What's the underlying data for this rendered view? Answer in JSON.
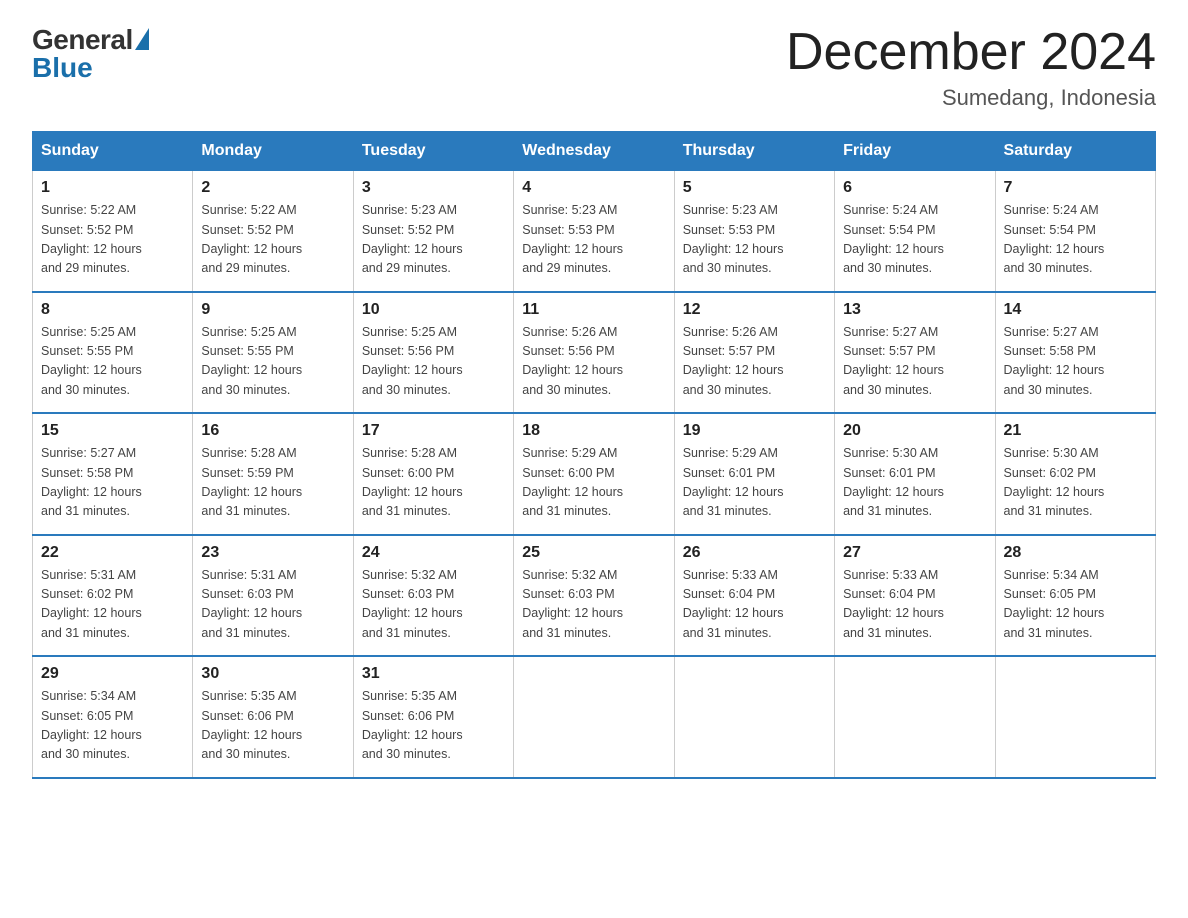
{
  "header": {
    "logo_general": "General",
    "logo_blue": "Blue",
    "title": "December 2024",
    "location": "Sumedang, Indonesia"
  },
  "days_of_week": [
    "Sunday",
    "Monday",
    "Tuesday",
    "Wednesday",
    "Thursday",
    "Friday",
    "Saturday"
  ],
  "weeks": [
    [
      {
        "day": "1",
        "sunrise": "5:22 AM",
        "sunset": "5:52 PM",
        "daylight": "12 hours and 29 minutes."
      },
      {
        "day": "2",
        "sunrise": "5:22 AM",
        "sunset": "5:52 PM",
        "daylight": "12 hours and 29 minutes."
      },
      {
        "day": "3",
        "sunrise": "5:23 AM",
        "sunset": "5:52 PM",
        "daylight": "12 hours and 29 minutes."
      },
      {
        "day": "4",
        "sunrise": "5:23 AM",
        "sunset": "5:53 PM",
        "daylight": "12 hours and 29 minutes."
      },
      {
        "day": "5",
        "sunrise": "5:23 AM",
        "sunset": "5:53 PM",
        "daylight": "12 hours and 30 minutes."
      },
      {
        "day": "6",
        "sunrise": "5:24 AM",
        "sunset": "5:54 PM",
        "daylight": "12 hours and 30 minutes."
      },
      {
        "day": "7",
        "sunrise": "5:24 AM",
        "sunset": "5:54 PM",
        "daylight": "12 hours and 30 minutes."
      }
    ],
    [
      {
        "day": "8",
        "sunrise": "5:25 AM",
        "sunset": "5:55 PM",
        "daylight": "12 hours and 30 minutes."
      },
      {
        "day": "9",
        "sunrise": "5:25 AM",
        "sunset": "5:55 PM",
        "daylight": "12 hours and 30 minutes."
      },
      {
        "day": "10",
        "sunrise": "5:25 AM",
        "sunset": "5:56 PM",
        "daylight": "12 hours and 30 minutes."
      },
      {
        "day": "11",
        "sunrise": "5:26 AM",
        "sunset": "5:56 PM",
        "daylight": "12 hours and 30 minutes."
      },
      {
        "day": "12",
        "sunrise": "5:26 AM",
        "sunset": "5:57 PM",
        "daylight": "12 hours and 30 minutes."
      },
      {
        "day": "13",
        "sunrise": "5:27 AM",
        "sunset": "5:57 PM",
        "daylight": "12 hours and 30 minutes."
      },
      {
        "day": "14",
        "sunrise": "5:27 AM",
        "sunset": "5:58 PM",
        "daylight": "12 hours and 30 minutes."
      }
    ],
    [
      {
        "day": "15",
        "sunrise": "5:27 AM",
        "sunset": "5:58 PM",
        "daylight": "12 hours and 31 minutes."
      },
      {
        "day": "16",
        "sunrise": "5:28 AM",
        "sunset": "5:59 PM",
        "daylight": "12 hours and 31 minutes."
      },
      {
        "day": "17",
        "sunrise": "5:28 AM",
        "sunset": "6:00 PM",
        "daylight": "12 hours and 31 minutes."
      },
      {
        "day": "18",
        "sunrise": "5:29 AM",
        "sunset": "6:00 PM",
        "daylight": "12 hours and 31 minutes."
      },
      {
        "day": "19",
        "sunrise": "5:29 AM",
        "sunset": "6:01 PM",
        "daylight": "12 hours and 31 minutes."
      },
      {
        "day": "20",
        "sunrise": "5:30 AM",
        "sunset": "6:01 PM",
        "daylight": "12 hours and 31 minutes."
      },
      {
        "day": "21",
        "sunrise": "5:30 AM",
        "sunset": "6:02 PM",
        "daylight": "12 hours and 31 minutes."
      }
    ],
    [
      {
        "day": "22",
        "sunrise": "5:31 AM",
        "sunset": "6:02 PM",
        "daylight": "12 hours and 31 minutes."
      },
      {
        "day": "23",
        "sunrise": "5:31 AM",
        "sunset": "6:03 PM",
        "daylight": "12 hours and 31 minutes."
      },
      {
        "day": "24",
        "sunrise": "5:32 AM",
        "sunset": "6:03 PM",
        "daylight": "12 hours and 31 minutes."
      },
      {
        "day": "25",
        "sunrise": "5:32 AM",
        "sunset": "6:03 PM",
        "daylight": "12 hours and 31 minutes."
      },
      {
        "day": "26",
        "sunrise": "5:33 AM",
        "sunset": "6:04 PM",
        "daylight": "12 hours and 31 minutes."
      },
      {
        "day": "27",
        "sunrise": "5:33 AM",
        "sunset": "6:04 PM",
        "daylight": "12 hours and 31 minutes."
      },
      {
        "day": "28",
        "sunrise": "5:34 AM",
        "sunset": "6:05 PM",
        "daylight": "12 hours and 31 minutes."
      }
    ],
    [
      {
        "day": "29",
        "sunrise": "5:34 AM",
        "sunset": "6:05 PM",
        "daylight": "12 hours and 30 minutes."
      },
      {
        "day": "30",
        "sunrise": "5:35 AM",
        "sunset": "6:06 PM",
        "daylight": "12 hours and 30 minutes."
      },
      {
        "day": "31",
        "sunrise": "5:35 AM",
        "sunset": "6:06 PM",
        "daylight": "12 hours and 30 minutes."
      },
      null,
      null,
      null,
      null
    ]
  ],
  "labels": {
    "sunrise": "Sunrise:",
    "sunset": "Sunset:",
    "daylight": "Daylight:"
  }
}
